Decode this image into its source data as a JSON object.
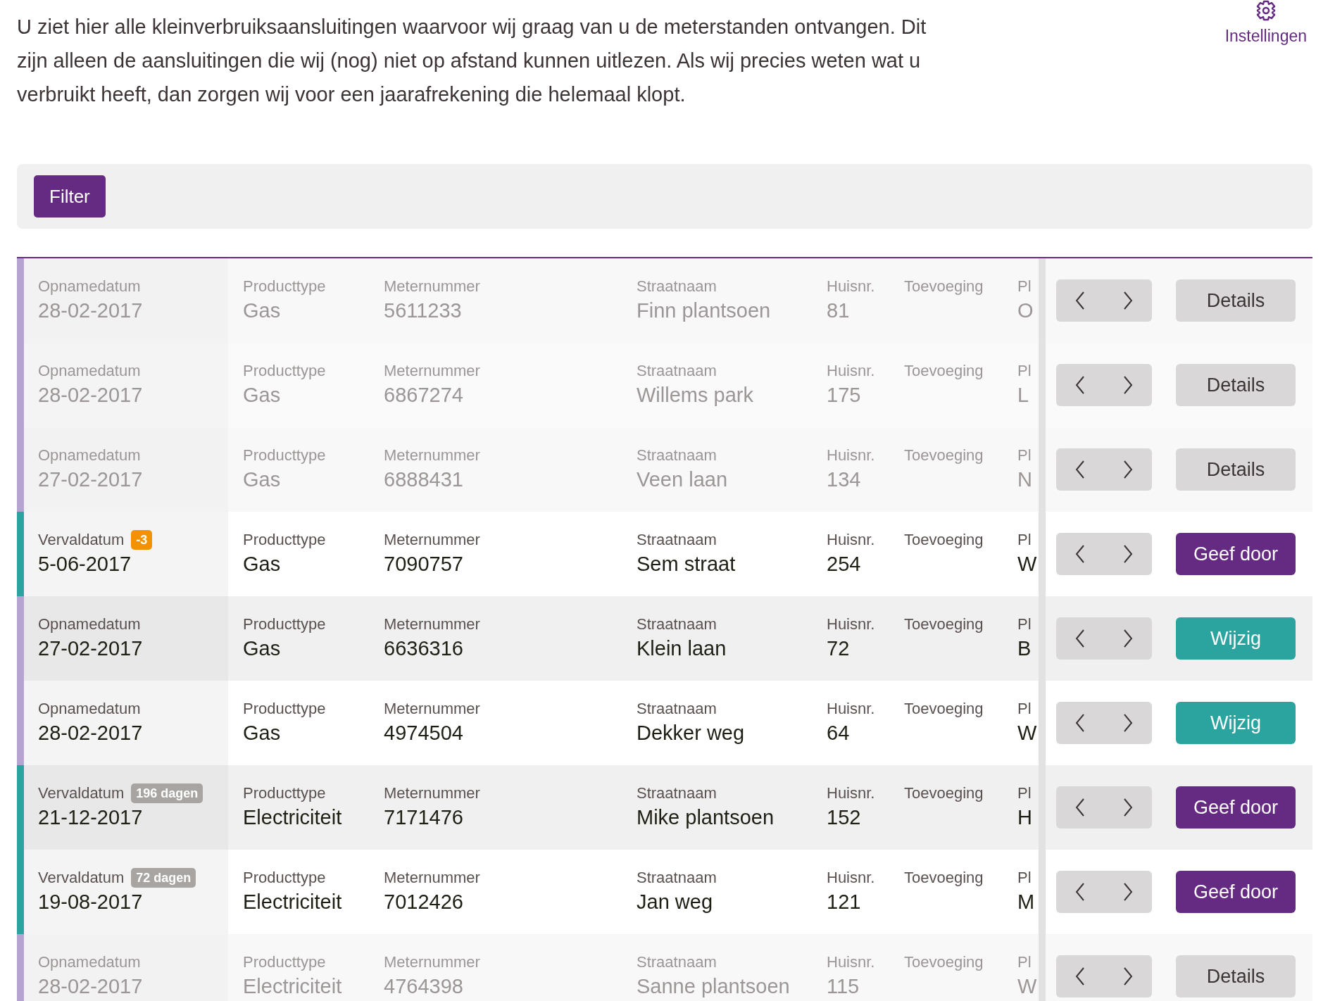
{
  "intro": "U ziet hier alle kleinverbruiksaansluitingen waarvoor wij graag van u de meterstanden ontvangen. Dit zijn alleen de aansluitingen die wij (nog) niet op afstand kunnen uitlezen. Als wij precies weten wat u verbruikt heeft, dan zorgen wij voor een jaarafrekening die helemaal klopt.",
  "settings": {
    "label": "Instellingen"
  },
  "filter": {
    "label": "Filter"
  },
  "rows": [
    {
      "kind": "opname",
      "muted": true,
      "date_label": "Opnamedatum",
      "date": "28-02-2017",
      "product_label": "Producttype",
      "product": "Gas",
      "meter_label": "Meternummer",
      "meter": "5611233",
      "street_label": "Straatnaam",
      "street": "Finn plantsoen",
      "house_label": "Huisnr.",
      "house": "81",
      "addition_label": "Toevoeging",
      "place_label": "Pl",
      "place": "O",
      "action": {
        "kind": "details",
        "label": "Details"
      }
    },
    {
      "kind": "opname",
      "muted": true,
      "date_label": "Opnamedatum",
      "date": "28-02-2017",
      "product_label": "Producttype",
      "product": "Gas",
      "meter_label": "Meternummer",
      "meter": "6867274",
      "street_label": "Straatnaam",
      "street": "Willems park",
      "house_label": "Huisnr.",
      "house": "175",
      "addition_label": "Toevoeging",
      "place_label": "Pl",
      "place": "L",
      "action": {
        "kind": "details",
        "label": "Details"
      }
    },
    {
      "kind": "opname",
      "muted": true,
      "date_label": "Opnamedatum",
      "date": "27-02-2017",
      "product_label": "Producttype",
      "product": "Gas",
      "meter_label": "Meternummer",
      "meter": "6888431",
      "street_label": "Straatnaam",
      "street": "Veen laan",
      "house_label": "Huisnr.",
      "house": "134",
      "addition_label": "Toevoeging",
      "place_label": "Pl",
      "place": "N",
      "action": {
        "kind": "details",
        "label": "Details"
      }
    },
    {
      "kind": "verval",
      "muted": false,
      "date_label": "Vervaldatum",
      "badge": {
        "text": "-3",
        "color": "#f39200"
      },
      "date": "5-06-2017",
      "product_label": "Producttype",
      "product": "Gas",
      "meter_label": "Meternummer",
      "meter": "7090757",
      "street_label": "Straatnaam",
      "street": "Sem straat",
      "house_label": "Huisnr.",
      "house": "254",
      "addition_label": "Toevoeging",
      "place_label": "Pl",
      "place": "W",
      "action": {
        "kind": "submit",
        "label": "Geef door"
      }
    },
    {
      "kind": "opname",
      "muted": false,
      "date_label": "Opnamedatum",
      "date": "27-02-2017",
      "product_label": "Producttype",
      "product": "Gas",
      "meter_label": "Meternummer",
      "meter": "6636316",
      "street_label": "Straatnaam",
      "street": "Klein laan",
      "house_label": "Huisnr.",
      "house": "72",
      "addition_label": "Toevoeging",
      "place_label": "Pl",
      "place": "B",
      "action": {
        "kind": "edit",
        "label": "Wijzig"
      }
    },
    {
      "kind": "opname",
      "muted": false,
      "date_label": "Opnamedatum",
      "date": "28-02-2017",
      "product_label": "Producttype",
      "product": "Gas",
      "meter_label": "Meternummer",
      "meter": "4974504",
      "street_label": "Straatnaam",
      "street": "Dekker weg",
      "house_label": "Huisnr.",
      "house": "64",
      "addition_label": "Toevoeging",
      "place_label": "Pl",
      "place": "W",
      "action": {
        "kind": "edit",
        "label": "Wijzig"
      }
    },
    {
      "kind": "verval",
      "muted": false,
      "date_label": "Vervaldatum",
      "badge": {
        "text": "196 dagen",
        "color": "#a8a4a2"
      },
      "date": "21-12-2017",
      "product_label": "Producttype",
      "product": "Electriciteit",
      "meter_label": "Meternummer",
      "meter": "7171476",
      "street_label": "Straatnaam",
      "street": "Mike plantsoen",
      "house_label": "Huisnr.",
      "house": "152",
      "addition_label": "Toevoeging",
      "place_label": "Pl",
      "place": "H",
      "action": {
        "kind": "submit",
        "label": "Geef door"
      }
    },
    {
      "kind": "verval",
      "muted": false,
      "date_label": "Vervaldatum",
      "badge": {
        "text": "72 dagen",
        "color": "#a8a4a2"
      },
      "date": "19-08-2017",
      "product_label": "Producttype",
      "product": "Electriciteit",
      "meter_label": "Meternummer",
      "meter": "7012426",
      "street_label": "Straatnaam",
      "street": "Jan weg",
      "house_label": "Huisnr.",
      "house": "121",
      "addition_label": "Toevoeging",
      "place_label": "Pl",
      "place": "M",
      "action": {
        "kind": "submit",
        "label": "Geef door"
      }
    },
    {
      "kind": "opname",
      "muted": true,
      "date_label": "Opnamedatum",
      "date": "28-02-2017",
      "product_label": "Producttype",
      "product": "Electriciteit",
      "meter_label": "Meternummer",
      "meter": "4764398",
      "street_label": "Straatnaam",
      "street": "Sanne plantsoen",
      "house_label": "Huisnr.",
      "house": "115",
      "addition_label": "Toevoeging",
      "place_label": "Pl",
      "place": "W",
      "action": {
        "kind": "details",
        "label": "Details"
      }
    }
  ]
}
